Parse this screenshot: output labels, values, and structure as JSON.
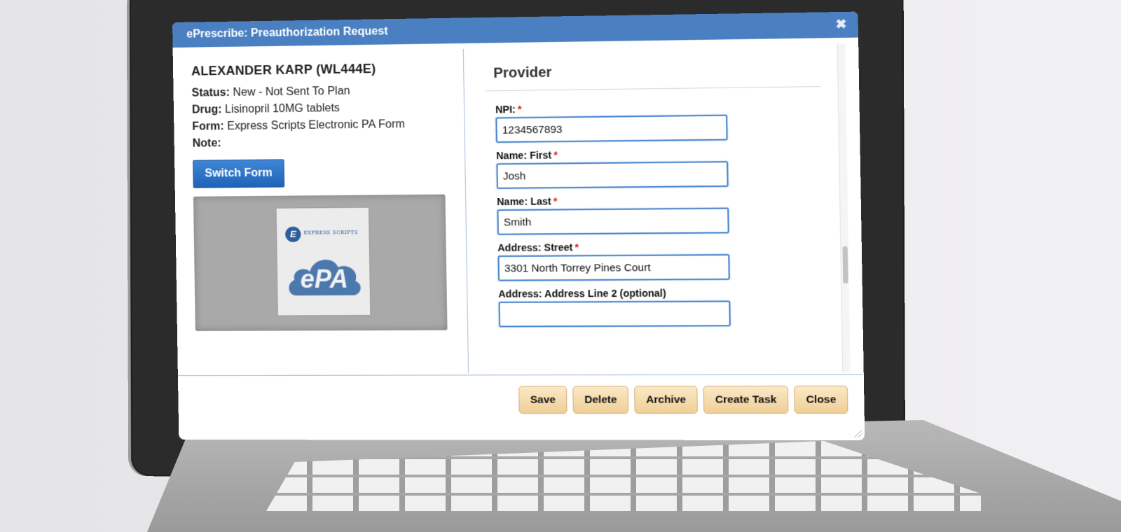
{
  "dialog": {
    "title": "ePrescribe: Preauthorization Request",
    "close_icon": "close-icon"
  },
  "patient": {
    "name": "ALEXANDER KARP (WL444E)",
    "status_label": "Status:",
    "status_value": "New - Not Sent To Plan",
    "drug_label": "Drug:",
    "drug_value": "Lisinopril 10MG tablets",
    "form_label": "Form:",
    "form_value": "Express Scripts Electronic PA Form",
    "note_label": "Note:",
    "note_value": "",
    "switch_form_label": "Switch Form"
  },
  "form_image": {
    "brand_text": "EXPRESS SCRIPTS",
    "logo_letter": "E",
    "badge_text": "ePA"
  },
  "provider": {
    "section_title": "Provider",
    "fields": [
      {
        "label": "NPI:",
        "required": true,
        "value": "1234567893"
      },
      {
        "label": "Name: First",
        "required": true,
        "value": "Josh"
      },
      {
        "label": "Name: Last",
        "required": true,
        "value": "Smith"
      },
      {
        "label": "Address: Street",
        "required": true,
        "value": "3301 North Torrey Pines Court"
      },
      {
        "label": "Address: Address Line 2 (optional)",
        "required": false,
        "value": ""
      }
    ],
    "required_mark": "*"
  },
  "footer": {
    "buttons": [
      "Save",
      "Delete",
      "Archive",
      "Create Task",
      "Close"
    ]
  },
  "colors": {
    "titlebar": "#4a7fc1",
    "primary_button": "#2a6fc7",
    "action_button": "#f3d9a8",
    "required": "#e01b1b"
  }
}
